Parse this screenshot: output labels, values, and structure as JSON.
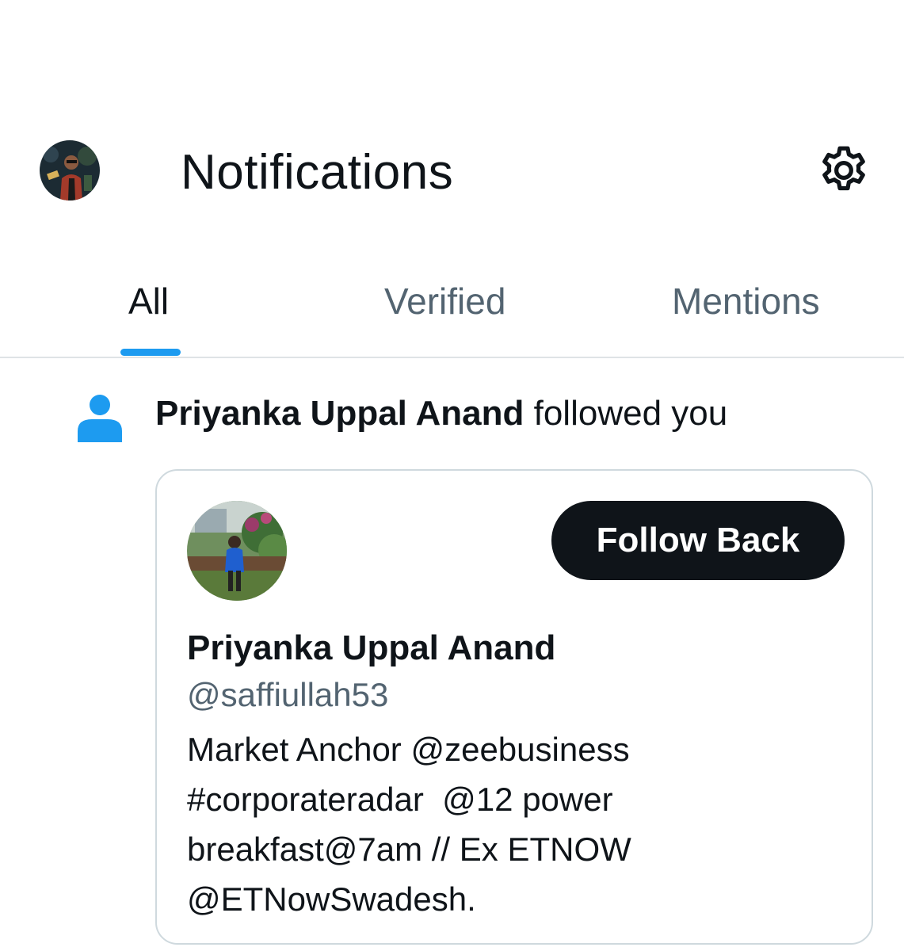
{
  "header": {
    "title": "Notifications",
    "settings_icon": "gear-icon",
    "avatar_icon": "avatar"
  },
  "tabs": [
    {
      "label": "All",
      "active": true
    },
    {
      "label": "Verified",
      "active": false
    },
    {
      "label": "Mentions",
      "active": false
    }
  ],
  "notification": {
    "icon": "person-icon",
    "user_name": "Priyanka Uppal Anand",
    "action_text": "followed you",
    "card": {
      "follow_button_label": "Follow Back",
      "display_name": "Priyanka Uppal Anand",
      "handle": "@saffiullah53",
      "bio_lines": [
        "Market Anchor @zeebusiness",
        "#corporateradar  @12 power",
        "breakfast@7am // Ex ETNOW",
        "@ETNowSwadesh."
      ]
    }
  },
  "colors": {
    "accent": "#1d9bf0",
    "text_primary": "#0f1419",
    "text_secondary": "#536471",
    "border": "#cfd9de",
    "button_bg": "#0f1419"
  }
}
